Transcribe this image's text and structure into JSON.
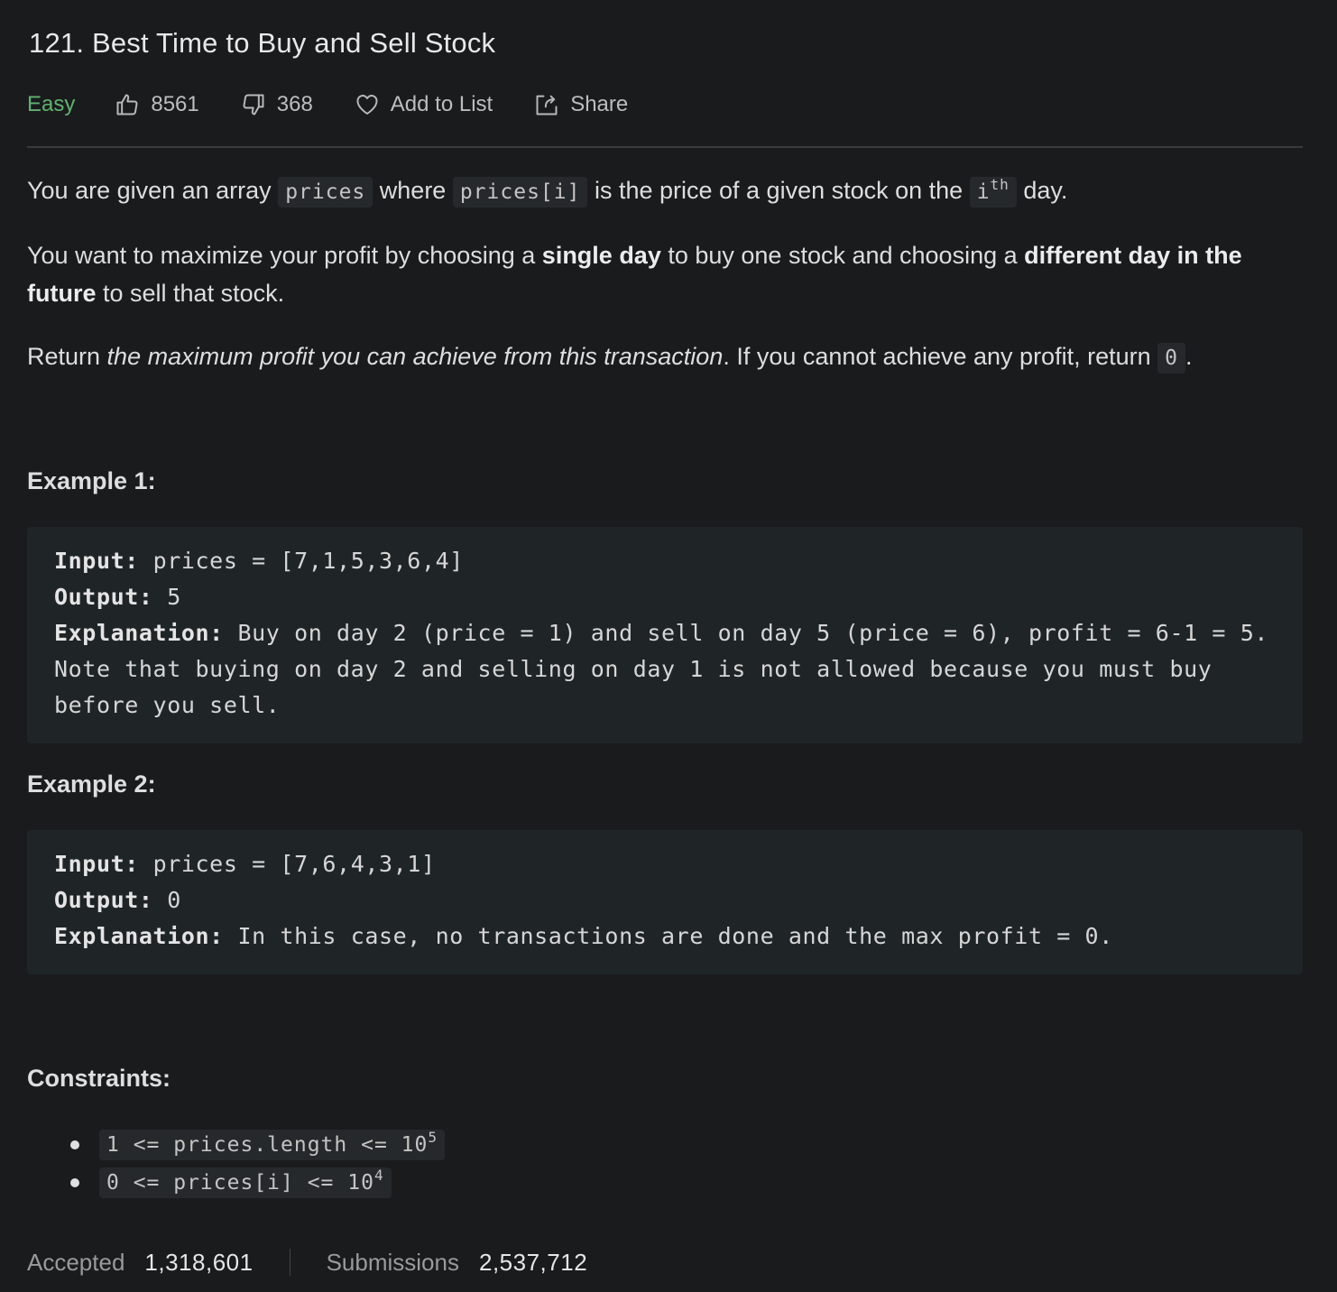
{
  "problem": {
    "title": "121. Best Time to Buy and Sell Stock",
    "difficulty": "Easy",
    "likes": "8561",
    "dislikes": "368",
    "add_to_list": "Add to List",
    "share": "Share"
  },
  "description": {
    "p1": {
      "t1": "You are given an array ",
      "c1": "prices",
      "t2": " where ",
      "c2": "prices[i]",
      "t3": " is the price of a given stock on the ",
      "c3": "i",
      "c3_sup": "th",
      "t4": " day."
    },
    "p2": {
      "t1": "You want to maximize your profit by choosing a ",
      "b1": "single day",
      "t2": " to buy one stock and choosing a ",
      "b2": "different day in the future",
      "t3": " to sell that stock."
    },
    "p3": {
      "t1": "Return ",
      "i1": "the maximum profit you can achieve from this transaction",
      "t2": ". If you cannot achieve any profit, return ",
      "c1": "0",
      "t3": "."
    }
  },
  "examples": [
    {
      "title": "Example 1:",
      "input_label": "Input:",
      "input": " prices = [7,1,5,3,6,4]",
      "output_label": "Output:",
      "output": " 5",
      "explanation_label": "Explanation:",
      "explanation": " Buy on day 2 (price = 1) and sell on day 5 (price = 6), profit = 6-1 = 5.\nNote that buying on day 2 and selling on day 1 is not allowed because you must buy before you sell."
    },
    {
      "title": "Example 2:",
      "input_label": "Input:",
      "input": " prices = [7,6,4,3,1]",
      "output_label": "Output:",
      "output": " 0",
      "explanation_label": "Explanation:",
      "explanation": " In this case, no transactions are done and the max profit = 0."
    }
  ],
  "constraints": {
    "title": "Constraints:",
    "items": [
      {
        "text": "1 <= prices.length <= 10",
        "sup": "5"
      },
      {
        "text": "0 <= prices[i] <= 10",
        "sup": "4"
      }
    ]
  },
  "stats": {
    "accepted_label": "Accepted",
    "accepted": "1,318,601",
    "submissions_label": "Submissions",
    "submissions": "2,537,712"
  },
  "colors": {
    "background": "#1a1b1d",
    "easy": "#5fb36f",
    "code_block_bg": "#1f2527",
    "inline_code_bg": "#26292b"
  },
  "icons": [
    "thumbs-up-icon",
    "thumbs-down-icon",
    "heart-icon",
    "share-icon"
  ]
}
